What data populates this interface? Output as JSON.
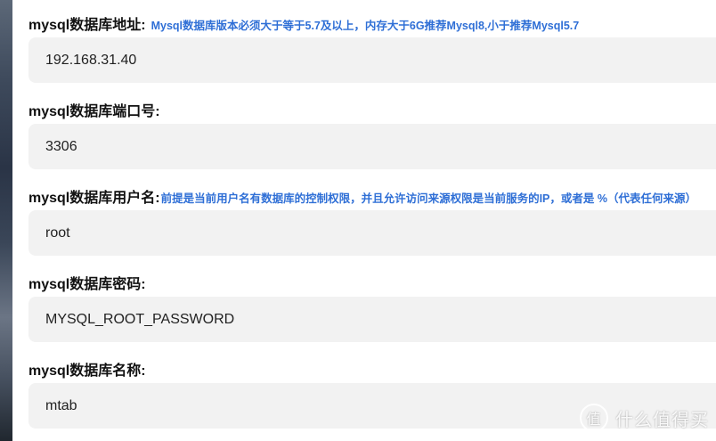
{
  "fields": [
    {
      "label": "mysql数据库地址:",
      "hint": "Mysql数据库版本必须大于等于5.7及以上，内存大于6G推荐Mysql8,小于推荐Mysql5.7",
      "value": "192.168.31.40"
    },
    {
      "label": "mysql数据库端口号:",
      "hint": "",
      "value": "3306"
    },
    {
      "label": "mysql数据库用户名:",
      "hint": "前提是当前用户名有数据库的控制权限，并且允许访问来源权限是当前服务的IP，或者是 %（代表任何来源）",
      "value": "root"
    },
    {
      "label": "mysql数据库密码:",
      "hint": "",
      "value": "MYSQL_ROOT_PASSWORD"
    },
    {
      "label": "mysql数据库名称:",
      "hint": "",
      "value": "mtab"
    }
  ],
  "watermark": {
    "logo_text": "值",
    "text": "什么值得买"
  }
}
